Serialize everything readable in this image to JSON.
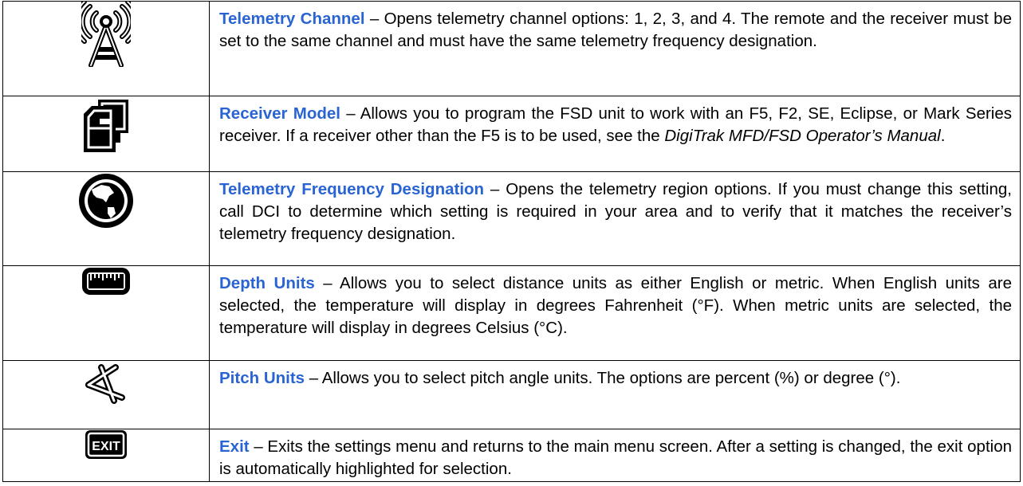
{
  "rows": [
    {
      "icon": "telemetry-antenna-icon",
      "term": "Telemetry Channel",
      "desc": " – Opens telemetry channel options: 1, 2, 3, and 4. The remote and the receiver must be set to the same channel and must have the same telemetry frequency designation."
    },
    {
      "icon": "receiver-model-icon",
      "term": "Receiver Model",
      "desc": " – Allows you to program the FSD unit to work with an F5, F2, SE, Eclipse, or Mark Series receiver. If a receiver other than the F5 is to be used, see the ",
      "italic": "DigiTrak MFD/FSD Operator’s Manual",
      "desc_end": "."
    },
    {
      "icon": "globe-icon",
      "term": "Telemetry Frequency Designation",
      "desc": " – Opens the telemetry region options. If you must change this setting, call DCI to determine which setting is required in your area and to verify that it matches the receiver’s telemetry frequency designation."
    },
    {
      "icon": "ruler-icon",
      "term": "Depth Units",
      "desc": " – Allows you to select distance units as either English or metric. When English units are selected, the temperature will display in degrees Fahrenheit (°F). When metric units are selected, the temperature will display in degrees Celsius (°C)."
    },
    {
      "icon": "pitch-icon",
      "term": "Pitch Units",
      "desc": " – Allows you to select pitch angle units. The options are percent (%) or degree (°)."
    },
    {
      "icon": "exit-icon",
      "term": "Exit",
      "desc": " – Exits the settings menu and returns to the main menu screen. After a setting is changed, the exit option is automatically highlighted for selection."
    }
  ]
}
